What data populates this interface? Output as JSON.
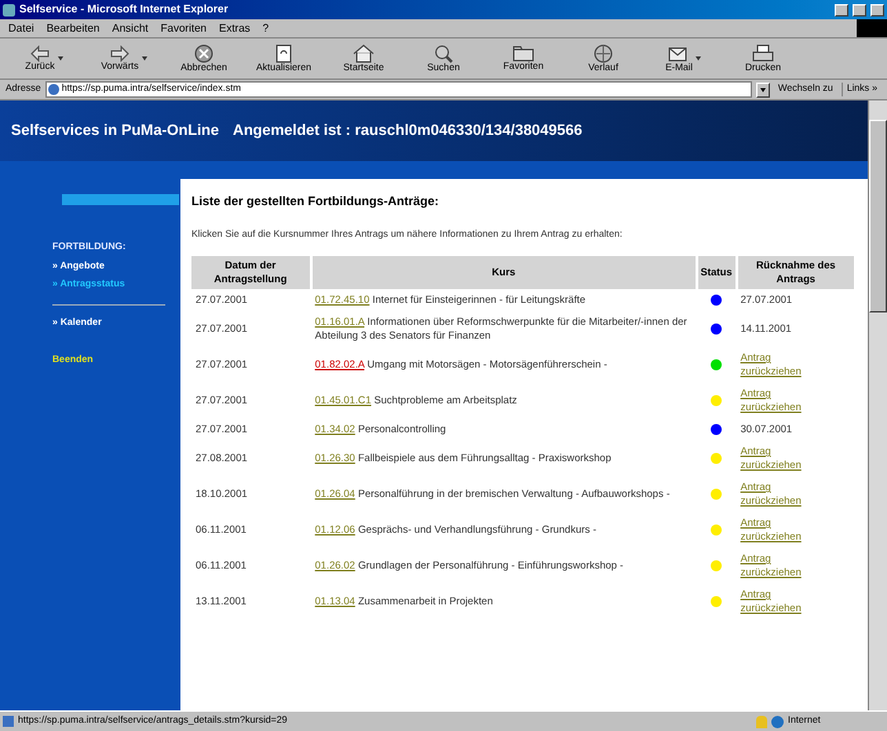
{
  "window": {
    "title": "Selfservice - Microsoft Internet Explorer"
  },
  "menu": [
    "Datei",
    "Bearbeiten",
    "Ansicht",
    "Favoriten",
    "Extras",
    "?"
  ],
  "toolbar": [
    {
      "label": "Zurück",
      "kind": "back",
      "dropdown": true
    },
    {
      "label": "Vorwärts",
      "kind": "forward",
      "dropdown": true
    },
    {
      "label": "Abbrechen",
      "kind": "stop",
      "dropdown": false
    },
    {
      "label": "Aktualisieren",
      "kind": "refresh",
      "dropdown": false
    },
    {
      "label": "Startseite",
      "kind": "home",
      "dropdown": false
    },
    {
      "label": "Suchen",
      "kind": "search",
      "dropdown": false
    },
    {
      "label": "Favoriten",
      "kind": "favorites",
      "dropdown": false
    },
    {
      "label": "Verlauf",
      "kind": "history",
      "dropdown": false
    },
    {
      "label": "E-Mail",
      "kind": "mail",
      "dropdown": true
    },
    {
      "label": "Drucken",
      "kind": "print",
      "dropdown": false
    }
  ],
  "address_bar": {
    "label": "Adresse",
    "value": "https://sp.puma.intra/selfservice/index.stm",
    "go": "Wechseln zu",
    "links": "Links »"
  },
  "header": {
    "title": "Selfservices in PuMa-OnLine",
    "user": "Angemeldet ist : rauschl0m046330/134/38049566"
  },
  "sidebar": {
    "section": "FORTBILDUNG:",
    "items": [
      {
        "label": "» Angebote",
        "selected": false
      },
      {
        "label": "» Antragsstatus",
        "selected": true
      }
    ],
    "calendar": "» Kalender",
    "exit": "Beenden"
  },
  "content": {
    "title": "Liste der gestellten Fortbildungs-Anträge:",
    "instruction": "Klicken Sie auf die Kursnummer Ihres Antrags um nähere Informationen zu Ihrem Antrag zu erhalten:",
    "table": {
      "columns": [
        "Datum der Antragstellung",
        "Kurs",
        "Status",
        "Rücknahme des Antrags"
      ],
      "rows": [
        {
          "date": "27.07.2001",
          "code": "01.72.45.10",
          "highlighted": false,
          "course": "Internet für Einsteigerinnen - für Leitungskräfte",
          "color": "#0000ff",
          "withdrawal": {
            "kind": "date",
            "text": "27.07.2001"
          }
        },
        {
          "date": "27.07.2001",
          "code": "01.16.01.A",
          "highlighted": false,
          "course": "Informationen über Reformschwerpunkte für die Mitarbeiter/-innen der Abteilung 3 des Senators für Finanzen",
          "color": "#0000ff",
          "withdrawal": {
            "kind": "date",
            "text": "14.11.2001"
          }
        },
        {
          "date": "27.07.2001",
          "code": "01.82.02.A",
          "highlighted": true,
          "course": "Umgang mit Motorsägen - Motorsägenführerschein -",
          "color": "#00e000",
          "withdrawal": {
            "kind": "link",
            "text": "Antrag zurückziehen"
          }
        },
        {
          "date": "27.07.2001",
          "code": "01.45.01.C1",
          "highlighted": false,
          "course": "Suchtprobleme am Arbeitsplatz",
          "color": "#ffee00",
          "withdrawal": {
            "kind": "link",
            "text": "Antrag zurückziehen"
          }
        },
        {
          "date": "27.07.2001",
          "code": "01.34.02",
          "highlighted": false,
          "course": "Personalcontrolling",
          "color": "#0000ff",
          "withdrawal": {
            "kind": "date",
            "text": "30.07.2001"
          }
        },
        {
          "date": "27.08.2001",
          "code": "01.26.30",
          "highlighted": false,
          "course": "Fallbeispiele aus dem Führungsalltag - Praxisworkshop",
          "color": "#ffee00",
          "withdrawal": {
            "kind": "link",
            "text": "Antrag zurückziehen"
          }
        },
        {
          "date": "18.10.2001",
          "code": "01.26.04",
          "highlighted": false,
          "course": "Personalführung in der bremischen Verwaltung - Aufbauworkshops -",
          "color": "#ffee00",
          "withdrawal": {
            "kind": "link",
            "text": "Antrag zurückziehen"
          }
        },
        {
          "date": "06.11.2001",
          "code": "01.12.06",
          "highlighted": false,
          "course": "Gesprächs- und Verhandlungsführung - Grundkurs -",
          "color": "#ffee00",
          "withdrawal": {
            "kind": "link",
            "text": "Antrag zurückziehen"
          }
        },
        {
          "date": "06.11.2001",
          "code": "01.26.02",
          "highlighted": false,
          "course": "Grundlagen der Personalführung - Einführungsworkshop -",
          "color": "#ffee00",
          "withdrawal": {
            "kind": "link",
            "text": "Antrag zurückziehen"
          }
        },
        {
          "date": "13.11.2001",
          "code": "01.13.04",
          "highlighted": false,
          "course": "Zusammenarbeit in Projekten",
          "color": "#ffee00",
          "withdrawal": {
            "kind": "link",
            "text": "Antrag zurückziehen"
          }
        }
      ]
    }
  },
  "status_bar": {
    "url": "https://sp.puma.intra/selfservice/antrags_details.stm?kursid=29",
    "zone": "Internet"
  }
}
